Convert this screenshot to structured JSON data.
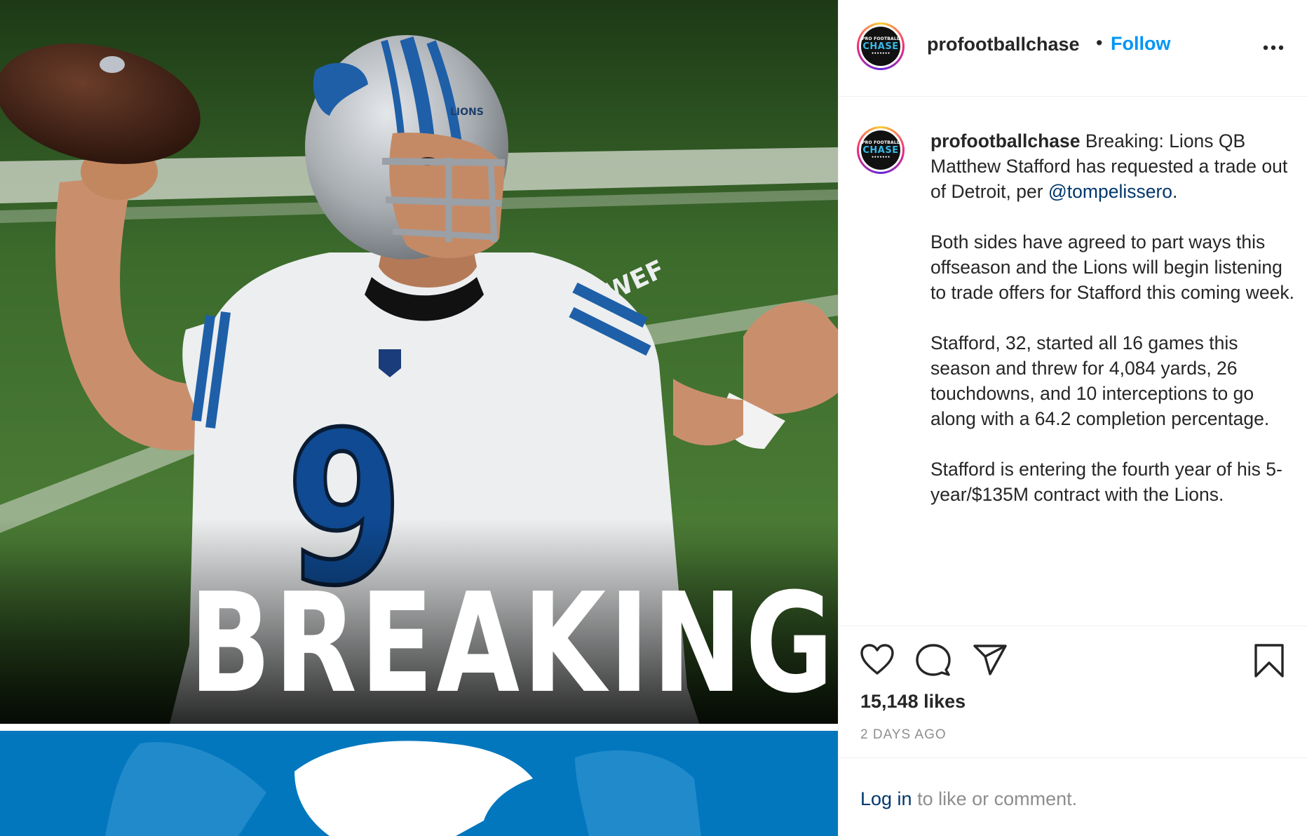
{
  "post": {
    "username": "profootballchase",
    "follow_label": "Follow",
    "separator": "•",
    "more_icon": "more-options-icon",
    "avatar": {
      "line1": "PRO FOOTBALL",
      "line2": "CHASE",
      "line3": "•••••••"
    },
    "image": {
      "overlay_text": "BREAKING",
      "jersey_number": "9",
      "helmet_text": "LIONS",
      "sleeve_text": "WEF",
      "banner_color": "#0277be"
    },
    "caption": {
      "username": "profootballchase",
      "text_1": " Breaking: Lions QB Matthew Stafford has requested a trade out of Detroit, per ",
      "mention": "@tompelissero",
      "text_2": ".\n\nBoth sides have agreed to part ways this offseason and the Lions will begin listening to trade offers for Stafford this coming week.\n\nStafford, 32, started all 16 games this season and threw for 4,084 yards, 26 touchdowns, and 10 interceptions to go along with a 64.2 completion percentage.\n\nStafford is entering the fourth year of his 5-year/$135M contract with the Lions."
    },
    "actions": {
      "like_icon": "heart-icon",
      "comment_icon": "comment-icon",
      "share_icon": "paper-plane-icon",
      "save_icon": "bookmark-icon"
    },
    "likes": "15,148 likes",
    "timestamp": "2 DAYS AGO",
    "login": {
      "link": "Log in",
      "rest": " to like or comment."
    },
    "colors": {
      "link": "#0095f6",
      "mention": "#00376b",
      "text": "#262626",
      "muted": "#8e8e8e"
    }
  }
}
